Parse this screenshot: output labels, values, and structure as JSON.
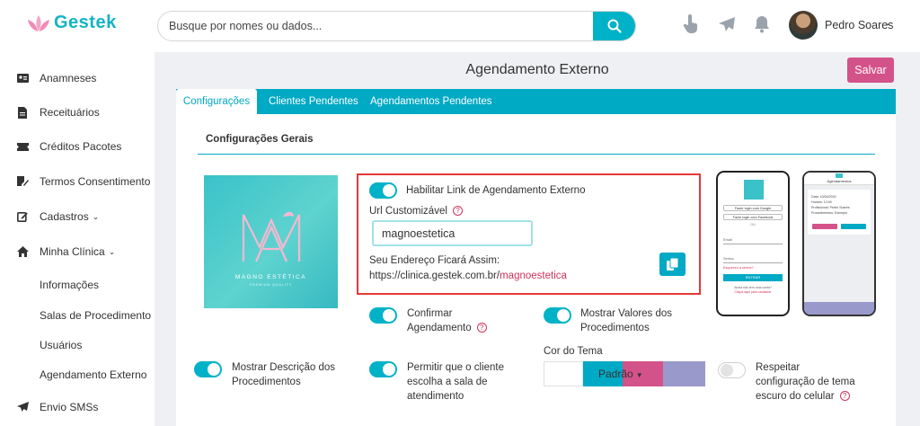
{
  "app": {
    "name": "Gestek"
  },
  "search": {
    "placeholder": "Busque por nomes ou dados..."
  },
  "user": {
    "name": "Pedro Soares"
  },
  "sidebar": {
    "items": [
      {
        "label": "Anamneses",
        "icon": "id-card-icon"
      },
      {
        "label": "Receituários",
        "icon": "document-icon"
      },
      {
        "label": "Créditos Pacotes",
        "icon": "ticket-icon"
      },
      {
        "label": "Termos Consentimento",
        "icon": "signature-icon"
      },
      {
        "label": "Cadastros",
        "icon": "edit-icon"
      },
      {
        "label": "Minha Clínica",
        "icon": "home-icon"
      }
    ],
    "submenu": [
      "Informações",
      "Salas de Procedimento",
      "Usuários",
      "Agendamento Externo"
    ],
    "last_item": {
      "label": "Envio SMSs",
      "icon": "send-icon"
    }
  },
  "page": {
    "title": "Agendamento Externo",
    "save_label": "Salvar"
  },
  "tabs": [
    "Configurações",
    "Clientes Pendentes",
    "Agendamentos Pendentes"
  ],
  "section": {
    "title": "Configurações Gerais"
  },
  "brand": {
    "name": "MAGNO ESTÉTICA",
    "tagline": "PREMIUM QUALITY"
  },
  "settings": {
    "enable_link_label": "Habilitar Link de Agendamento Externo",
    "custom_url_label": "Url Customizável",
    "custom_url_value": "magnoestetica",
    "address_label": "Seu Endereço Ficará Assim:",
    "address_base": "https://clinica.gestek.com.br/",
    "address_slug": "magnoestetica",
    "confirm_label_1": "Confirmar",
    "confirm_label_2": "Agendamento",
    "show_values_1": "Mostrar Valores dos",
    "show_values_2": "Procedimentos",
    "show_desc_1": "Mostrar Descrição dos",
    "show_desc_2": "Procedimentos",
    "allow_room_1": "Permitir que o cliente",
    "allow_room_2": "escolha a sala de",
    "allow_room_3": "atendimento",
    "theme_label": "Cor do Tema",
    "theme_selected": "Padrão",
    "dark_1": "Respeitar",
    "dark_2": "configuração de tema",
    "dark_3": "escuro do celular"
  },
  "toggles": {
    "enable_link": true,
    "confirm": true,
    "show_values": true,
    "show_desc": true,
    "allow_room": true,
    "dark_mode": false
  },
  "theme_colors": [
    "#ffffff",
    "#00a9c4",
    "#d4528a",
    "#9999cc"
  ],
  "phone_login": {
    "google": "Fazer login com Google",
    "facebook": "Fazer login com Facebook",
    "or": "OU",
    "email": "Email",
    "password": "Senha",
    "forgot": "Esqueceu a senha?",
    "enter": "ENTRAR",
    "no_account": "Ainda não tem uma conta?",
    "register": "Clique aqui para cadastrar"
  },
  "phone_booking": {
    "header": "Agendamentos",
    "date": "Data: 10/04/2024",
    "time": "Horário: 13:00",
    "professional": "Profissional: Pedro Soares",
    "procedure": "Procedimentos: Exemplo"
  }
}
